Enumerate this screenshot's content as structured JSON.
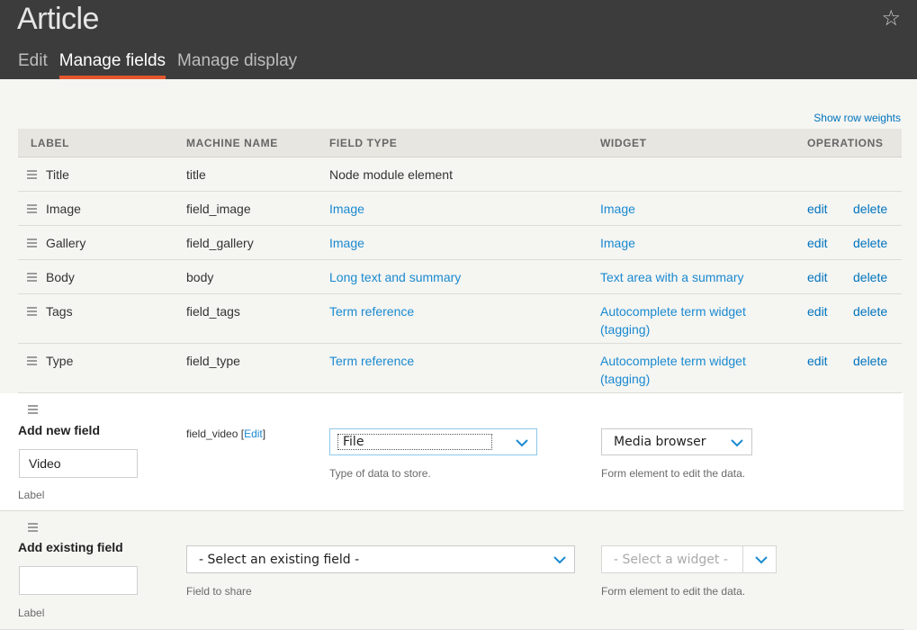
{
  "header": {
    "title": "Article",
    "star_icon": "star-icon",
    "tabs": [
      {
        "label": "Edit",
        "active": false
      },
      {
        "label": "Manage fields",
        "active": true
      },
      {
        "label": "Manage display",
        "active": false
      }
    ]
  },
  "show_row_weights": "Show row weights",
  "table": {
    "columns": [
      "LABEL",
      "MACHINE NAME",
      "FIELD TYPE",
      "WIDGET",
      "OPERATIONS"
    ],
    "rows": [
      {
        "label": "Title",
        "machine_name": "title",
        "field_type": "Node module element",
        "widget": "",
        "widget_line2": "",
        "edit": "",
        "delete": ""
      },
      {
        "label": "Image",
        "machine_name": "field_image",
        "field_type": "Image",
        "widget": "Image",
        "widget_line2": "",
        "edit": "edit",
        "delete": "delete"
      },
      {
        "label": "Gallery",
        "machine_name": "field_gallery",
        "field_type": "Image",
        "widget": "Image",
        "widget_line2": "",
        "edit": "edit",
        "delete": "delete"
      },
      {
        "label": "Body",
        "machine_name": "body",
        "field_type": "Long text and summary",
        "widget": "Text area with a summary",
        "widget_line2": "",
        "edit": "edit",
        "delete": "delete"
      },
      {
        "label": "Tags",
        "machine_name": "field_tags",
        "field_type": "Term reference",
        "widget": "Autocomplete term widget",
        "widget_line2": "(tagging)",
        "edit": "edit",
        "delete": "delete"
      },
      {
        "label": "Type",
        "machine_name": "field_type",
        "field_type": "Term reference",
        "widget": "Autocomplete term widget",
        "widget_line2": "(tagging)",
        "edit": "edit",
        "delete": "delete"
      }
    ]
  },
  "add_new_field": {
    "title": "Add new field",
    "label_value": "Video",
    "label_caption": "Label",
    "machine_name": "field_video",
    "machine_bracket_open": "[",
    "machine_edit_link": "Edit",
    "machine_bracket_close": "]",
    "field_type_value": "File",
    "field_type_caption": "Type of data to store.",
    "widget_value": "Media browser",
    "widget_caption": "Form element to edit the data."
  },
  "add_existing_field": {
    "title": "Add existing field",
    "label_value": "",
    "label_caption": "Label",
    "field_select": "- Select an existing field -",
    "field_caption": "Field to share",
    "widget_select": "- Select a widget -",
    "widget_caption": "Form element to edit the data."
  },
  "colors": {
    "accent": "#e4572e",
    "link": "#1a8ad0",
    "header_bg": "#3c3c3c"
  }
}
